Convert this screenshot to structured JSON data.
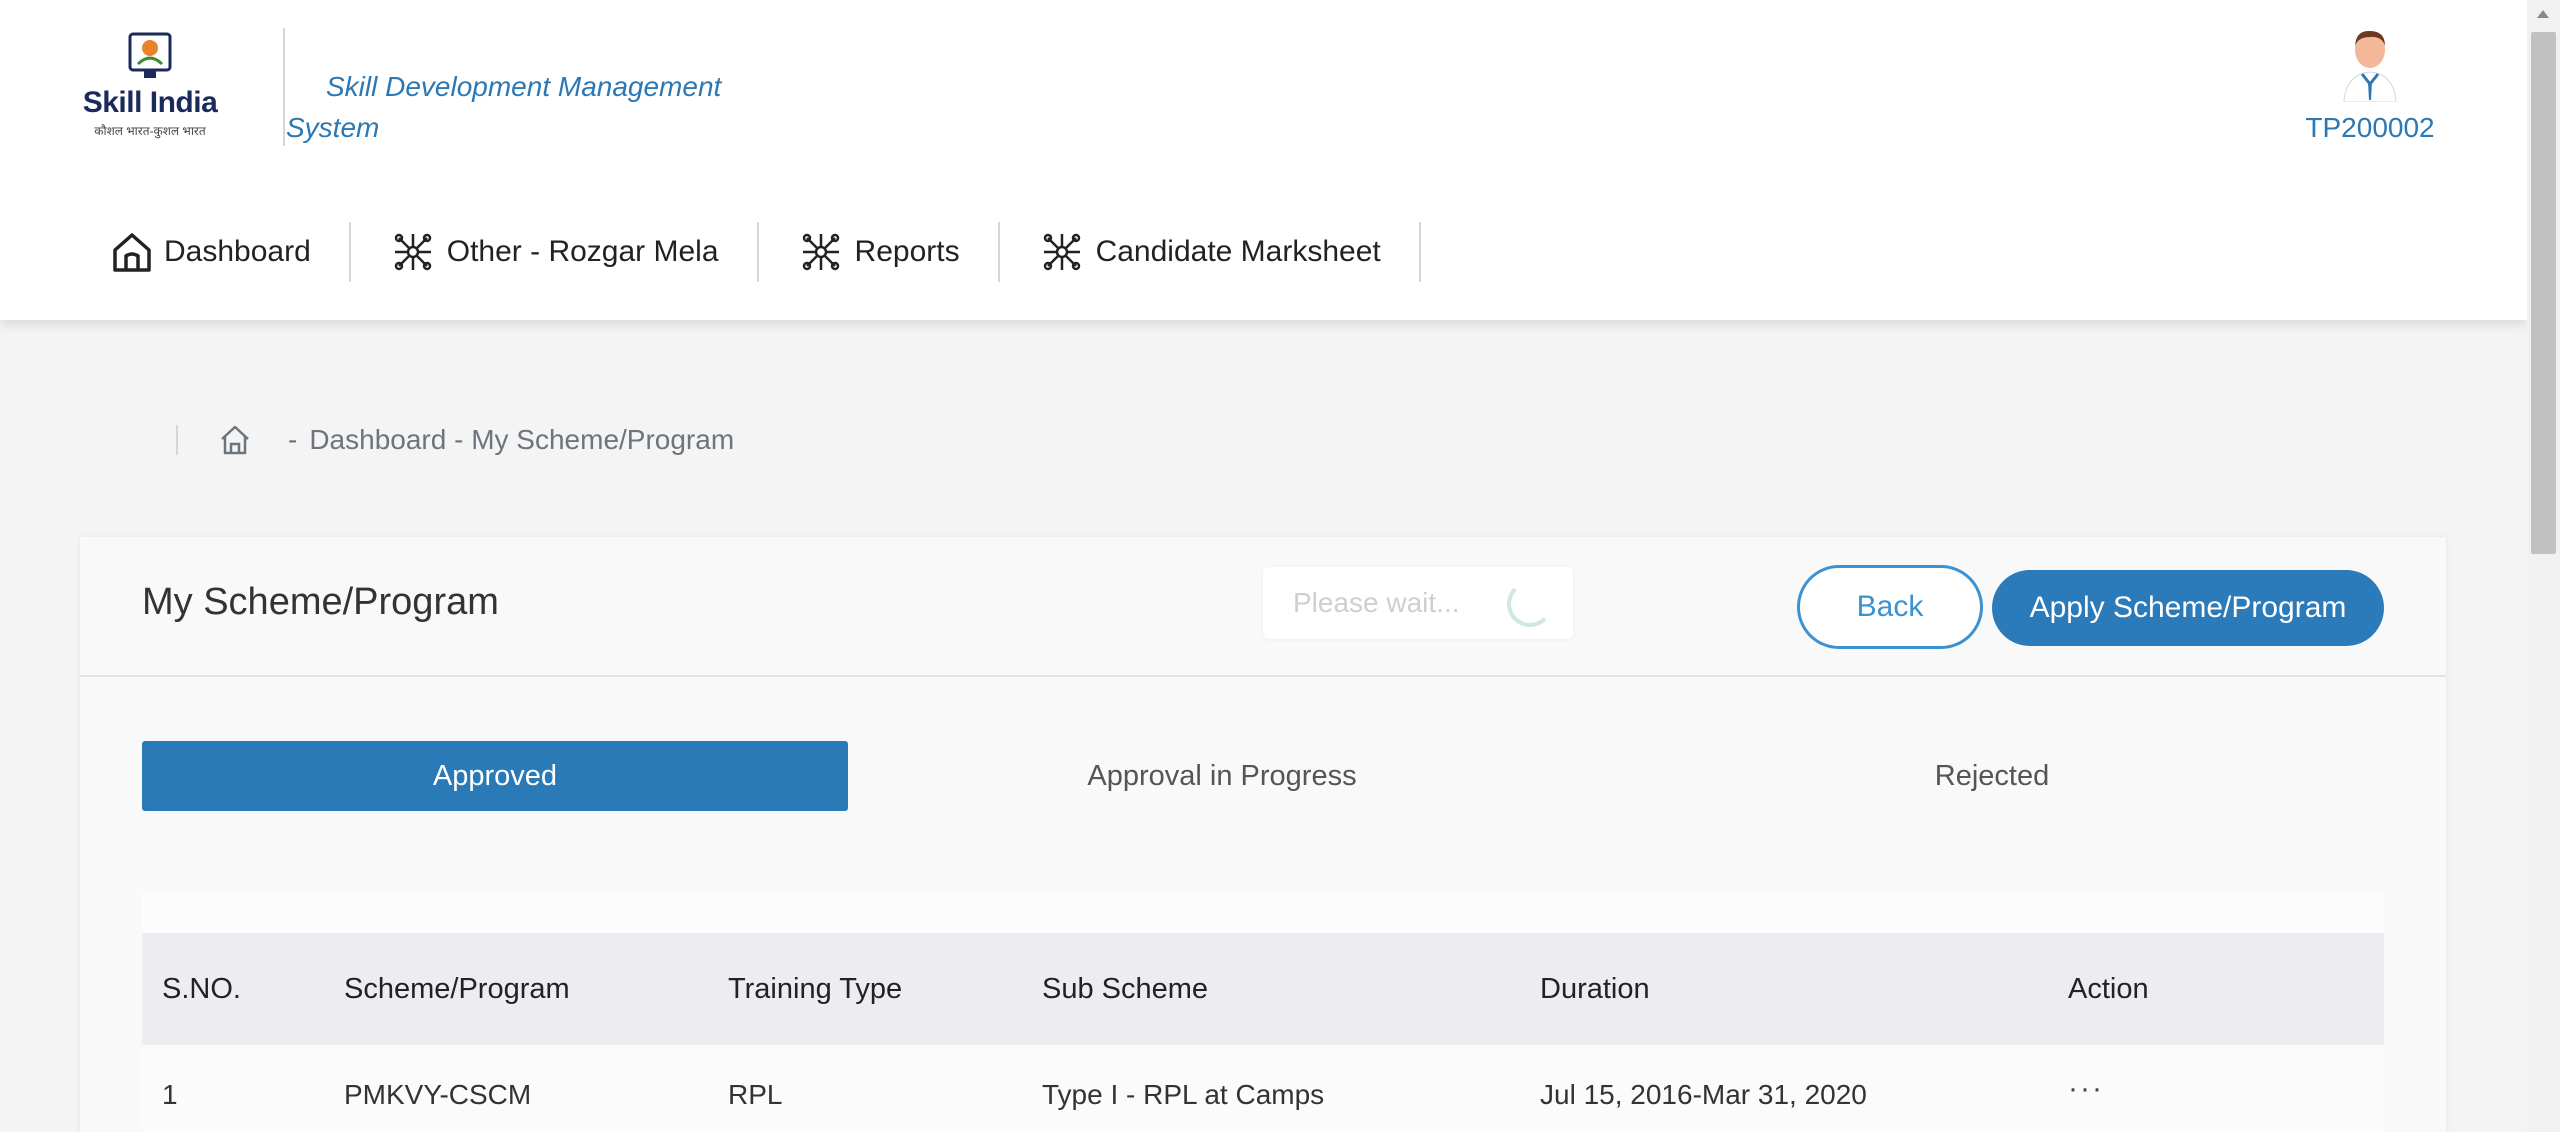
{
  "header": {
    "logo_text": "Skill India",
    "logo_subtext": "कौशल भारत-कुशल भारत",
    "app_title": "Skill Development Management System",
    "user_id": "TP200002"
  },
  "nav": {
    "items": [
      {
        "label": "Dashboard",
        "icon": "home-icon"
      },
      {
        "label": "Other - Rozgar Mela",
        "icon": "network-icon"
      },
      {
        "label": "Reports",
        "icon": "network-icon"
      },
      {
        "label": "Candidate Marksheet",
        "icon": "network-icon"
      }
    ]
  },
  "breadcrumb": {
    "dash": "-",
    "path": "Dashboard - My Scheme/Program"
  },
  "page": {
    "title": "My Scheme/Program",
    "loading_text": "Please wait...",
    "back_label": "Back",
    "apply_label": "Apply Scheme/Program"
  },
  "tabs": [
    {
      "label": "Approved",
      "active": true
    },
    {
      "label": "Approval in Progress",
      "active": false
    },
    {
      "label": "Rejected",
      "active": false
    }
  ],
  "table": {
    "headers": [
      "S.NO.",
      "Scheme/Program",
      "Training Type",
      "Sub Scheme",
      "Duration",
      "Action"
    ],
    "rows": [
      [
        "1",
        "PMKVY-CSCM",
        "RPL",
        "Type I - RPL at Camps",
        "Jul 15, 2016-Mar 31, 2020",
        "···"
      ]
    ]
  },
  "colors": {
    "primary": "#2b7ab9",
    "accent_text": "#2b78b5",
    "background": "#f4f4f4"
  }
}
